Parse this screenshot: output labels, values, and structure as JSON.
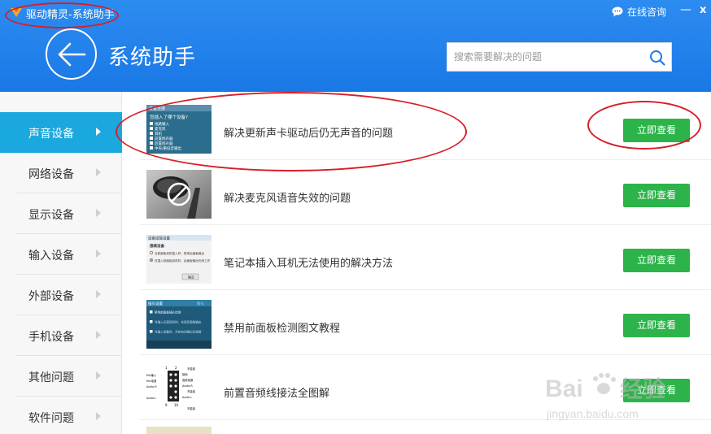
{
  "window": {
    "title": "驱动精灵-系统助手",
    "chat_label": "在线咨询",
    "minimize_glyph": "—",
    "close_glyph": "x"
  },
  "header": {
    "page_title": "系统助手",
    "search_placeholder": "搜索需要解决的问题"
  },
  "sidebar": {
    "items": [
      {
        "label": "声音设备",
        "active": true
      },
      {
        "label": "网络设备",
        "active": false
      },
      {
        "label": "显示设备",
        "active": false
      },
      {
        "label": "输入设备",
        "active": false
      },
      {
        "label": "外部设备",
        "active": false
      },
      {
        "label": "手机设备",
        "active": false
      },
      {
        "label": "其他问题",
        "active": false
      },
      {
        "label": "软件问题",
        "active": false
      }
    ]
  },
  "list": {
    "items": [
      {
        "title": "解决更新声卡驱动后仍无声音的问题",
        "button": "立即查看"
      },
      {
        "title": "解决麦克风语音失效的问题",
        "button": "立即查看"
      },
      {
        "title": "笔记本插入耳机无法使用的解决方法",
        "button": "立即查看"
      },
      {
        "title": "禁用前面板检测图文教程",
        "button": "立即查看"
      },
      {
        "title": "前置音频线接法全图解",
        "button": "立即查看"
      }
    ]
  },
  "thumbnails": {
    "t1": {
      "header": "设备连接",
      "question": "您插入了哪个设备?",
      "options": [
        "线路输入",
        "麦克风",
        "耳机",
        "前置扬声器",
        "后置扬声器",
        "中央/重低音输出"
      ]
    },
    "t3": {
      "header": "设备连接设置",
      "section": "接续设备",
      "option1": "当前面板耳机插入时，禁用后面板输出",
      "option2": "在插入前面板耳机时，后面板输出仍然工作",
      "ok": "确定"
    },
    "t4": {
      "header": "插头设置",
      "right": "接头",
      "line1": "禁用前面板插孔检测",
      "line2": "当插入正面耳机时，关闭后面板输出",
      "line3": "当插入设备时，开启自动弹出对话框"
    },
    "t5": {
      "pin_top": [
        "1",
        "2"
      ],
      "pin_bottom": [
        "9",
        "10"
      ],
      "left_labels": [
        "Mic输入",
        "Mic电源",
        "Audio R",
        "Audio L"
      ],
      "right_labels": [
        "不能接",
        "接地",
        "音频电源",
        "Audio R",
        "不能接",
        "Audio L",
        "不能接"
      ]
    }
  },
  "watermark": {
    "brand_left": "Bai",
    "brand_right": "经验",
    "url": "jingyan.baidu.com"
  },
  "colors": {
    "header_blue": "#1a7be8",
    "active_sidebar": "#1aa8de",
    "button_green": "#2cb34a",
    "annotation_red": "#d81e28"
  }
}
